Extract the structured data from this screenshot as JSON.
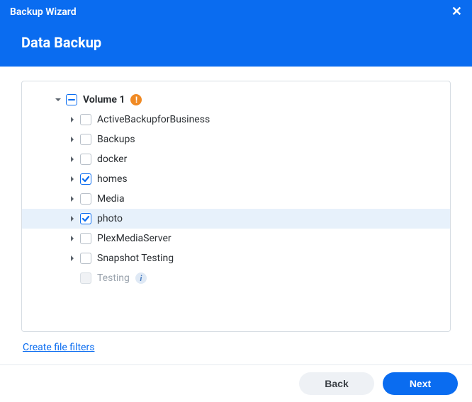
{
  "titlebar": {
    "title": "Backup Wizard"
  },
  "header": {
    "title": "Data Backup"
  },
  "tree": {
    "root": {
      "label": "Volume 1",
      "expanded": true,
      "check": "indeterminate",
      "warn": true,
      "children": [
        {
          "label": "ActiveBackupforBusiness",
          "check": "unchecked",
          "expandable": true
        },
        {
          "label": "Backups",
          "check": "unchecked",
          "expandable": true
        },
        {
          "label": "docker",
          "check": "unchecked",
          "expandable": true
        },
        {
          "label": "homes",
          "check": "checked",
          "expandable": true
        },
        {
          "label": "Media",
          "check": "unchecked",
          "expandable": true
        },
        {
          "label": "photo",
          "check": "checked",
          "expandable": true,
          "selected": true
        },
        {
          "label": "PlexMediaServer",
          "check": "unchecked",
          "expandable": true
        },
        {
          "label": "Snapshot Testing",
          "check": "unchecked",
          "expandable": true
        },
        {
          "label": "Testing",
          "check": "disabled",
          "expandable": false,
          "info": true,
          "muted": true
        }
      ]
    }
  },
  "links": {
    "create_filters": "Create file filters"
  },
  "footer": {
    "back": "Back",
    "next": "Next"
  },
  "badges": {
    "warn_glyph": "!",
    "info_glyph": "i"
  }
}
